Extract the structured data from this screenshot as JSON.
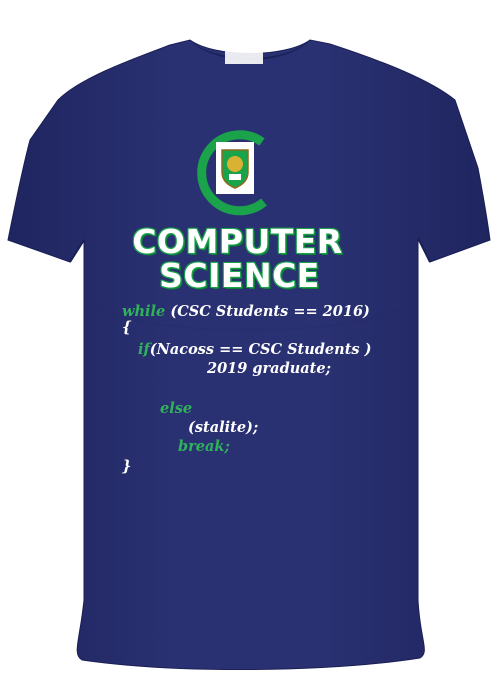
{
  "image": {
    "subject": "navy t-shirt",
    "colors": {
      "shirt": "#252b6b",
      "shirt_shadow": "#1c2159",
      "accent_green": "#1aa34a",
      "text": "#ffffff"
    }
  },
  "logo": {
    "icon": "crest-icon"
  },
  "title": {
    "line1": "COMPUTER",
    "line2": "SCIENCE"
  },
  "code": {
    "l1_kw": "while",
    "l1_rest": "(CSC Students == 2016)",
    "l2": "{",
    "l3_kw": "if",
    "l3_rest": "(Nacoss == CSC Students )",
    "l4": "2019 graduate;",
    "l5_kw": "else",
    "l6": "(stalite);",
    "l7_kw": "break;",
    "l8": "}"
  }
}
